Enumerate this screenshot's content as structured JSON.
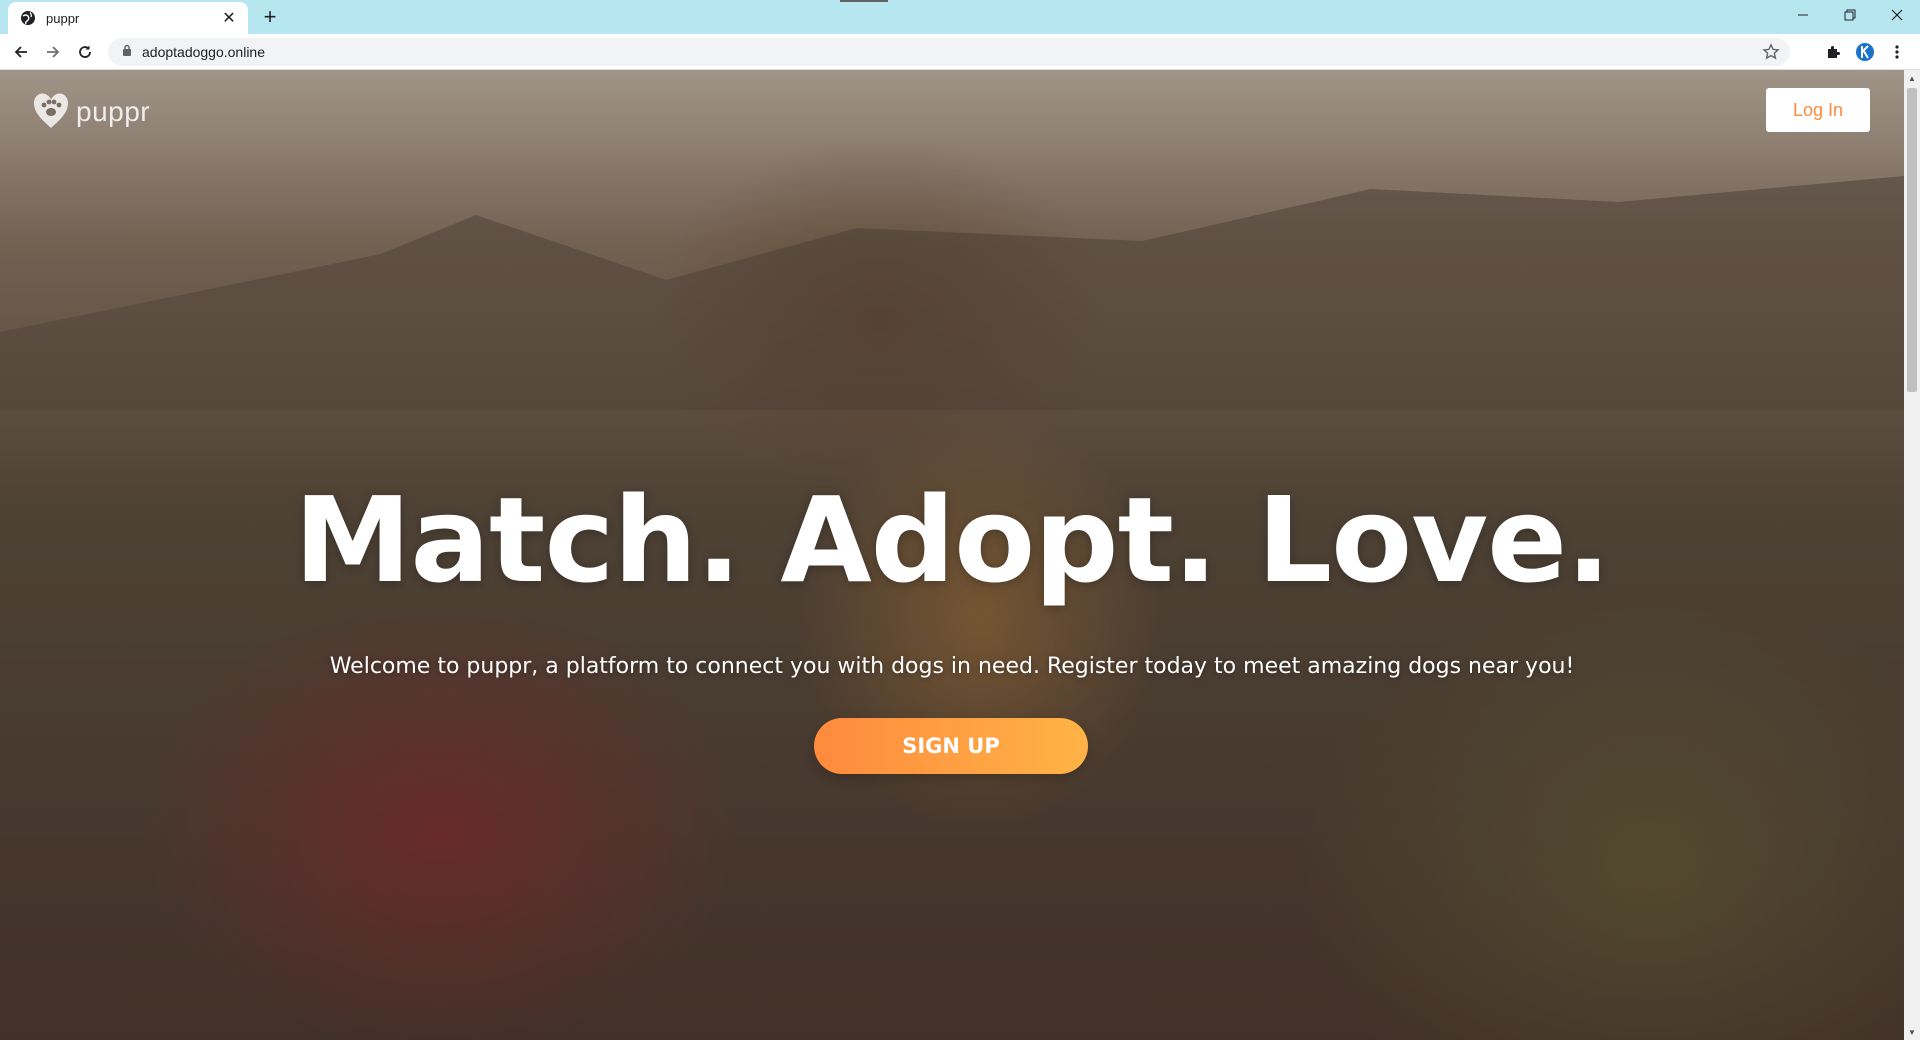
{
  "browser": {
    "tab_title": "puppr",
    "tab_close_symbol": "✕",
    "new_tab_symbol": "+",
    "url": "adoptadoggo.online",
    "tabstrip_color": "#b6e6f0"
  },
  "page": {
    "brand_name": "puppr",
    "login_label": "Log In",
    "hero_title": "Match. Adopt. Love.",
    "hero_subtitle": "Welcome to puppr, a platform to connect you with dogs in need. Register today to meet amazing dogs near you!",
    "signup_label": "SIGN UP",
    "accent_color": "#ff8a3d",
    "accent_gradient_end": "#ffb347"
  },
  "icons": {
    "favicon": "globe-icon",
    "back": "arrow-left-icon",
    "forward": "arrow-right-icon",
    "reload": "reload-icon",
    "lock": "lock-icon",
    "star": "star-icon",
    "extensions": "puzzle-icon",
    "profile_extension": "k-extension-icon",
    "menu": "kebab-menu-icon",
    "brand": "paw-heart-icon"
  }
}
